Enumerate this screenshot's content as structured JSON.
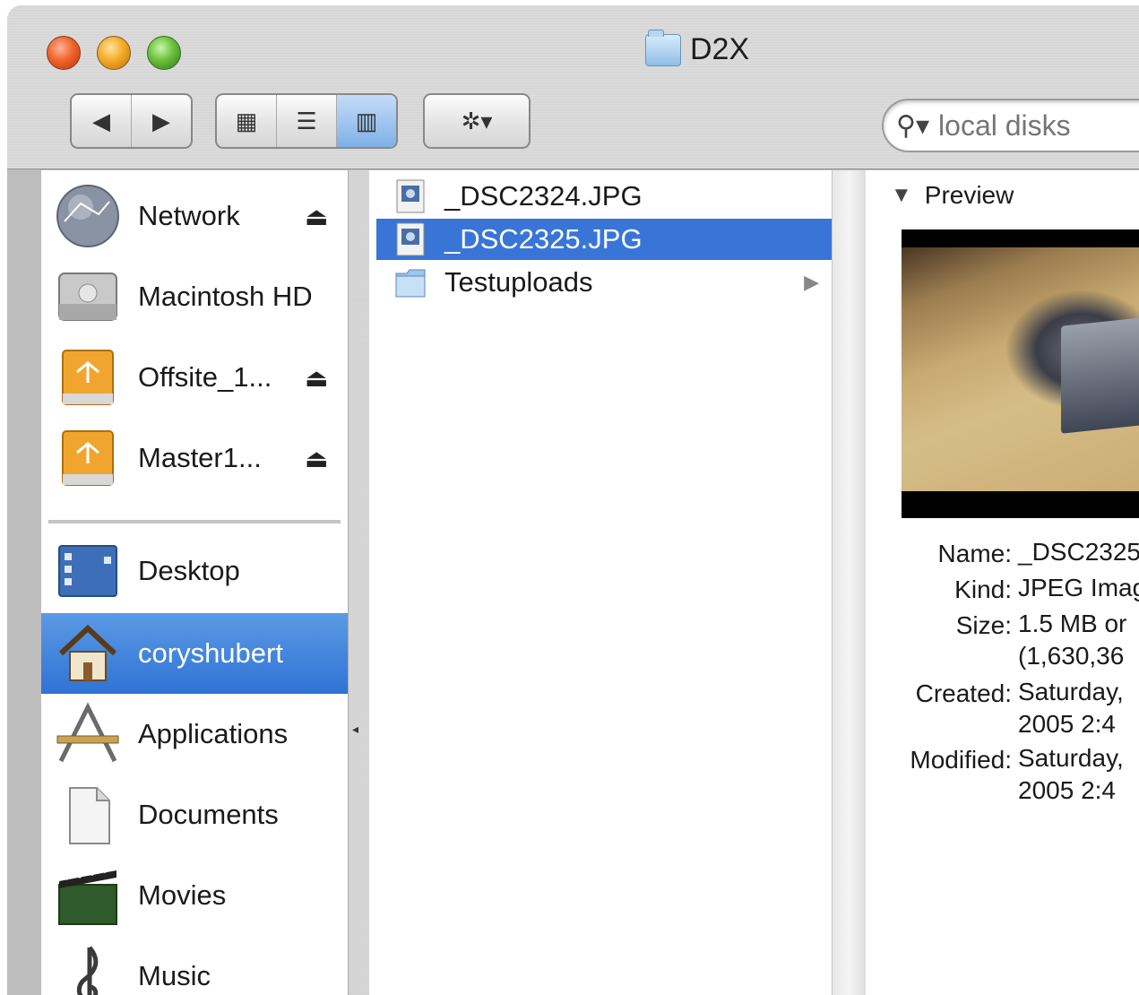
{
  "window": {
    "title": "D2X"
  },
  "toolbar": {
    "back_label": "◀",
    "forward_label": "▶",
    "view_icon_label": "▦",
    "view_list_label": "☰",
    "view_column_label": "▥",
    "action_label": "✲▾",
    "search_placeholder": "local disks"
  },
  "sidebar": {
    "items": [
      {
        "label": "Network",
        "icon": "network-globe-icon",
        "eject": true
      },
      {
        "label": "Macintosh HD",
        "icon": "hard-drive-icon",
        "eject": false
      },
      {
        "label": "Offsite_1...",
        "icon": "firewire-drive-icon",
        "eject": true
      },
      {
        "label": "Master1...",
        "icon": "firewire-drive-icon",
        "eject": true
      },
      {
        "label": "Desktop",
        "icon": "desktop-icon",
        "eject": false
      },
      {
        "label": "coryshubert",
        "icon": "home-icon",
        "eject": false,
        "selected": true
      },
      {
        "label": "Applications",
        "icon": "applications-icon",
        "eject": false
      },
      {
        "label": "Documents",
        "icon": "documents-icon",
        "eject": false
      },
      {
        "label": "Movies",
        "icon": "movies-icon",
        "eject": false
      },
      {
        "label": "Music",
        "icon": "music-icon",
        "eject": false
      }
    ]
  },
  "files": [
    {
      "name": "_DSC2324.JPG",
      "icon": "jpeg-file-icon"
    },
    {
      "name": "_DSC2325.JPG",
      "icon": "jpeg-file-icon",
      "selected": true
    },
    {
      "name": "Testuploads",
      "icon": "folder-icon",
      "has_children": true
    }
  ],
  "preview": {
    "title": "Preview",
    "info": [
      {
        "key": "Name:",
        "lines": [
          "_DSC2325"
        ]
      },
      {
        "key": "Kind:",
        "lines": [
          "JPEG Imag"
        ]
      },
      {
        "key": "Size:",
        "lines": [
          "1.5 MB or",
          "(1,630,36"
        ]
      },
      {
        "key": "Created:",
        "lines": [
          "Saturday,",
          "2005 2:4"
        ]
      },
      {
        "key": "Modified:",
        "lines": [
          "Saturday,",
          "2005 2:4"
        ]
      }
    ]
  },
  "colors": {
    "selection": "#3875d7",
    "sidebar_selection": "#2f73d6"
  }
}
